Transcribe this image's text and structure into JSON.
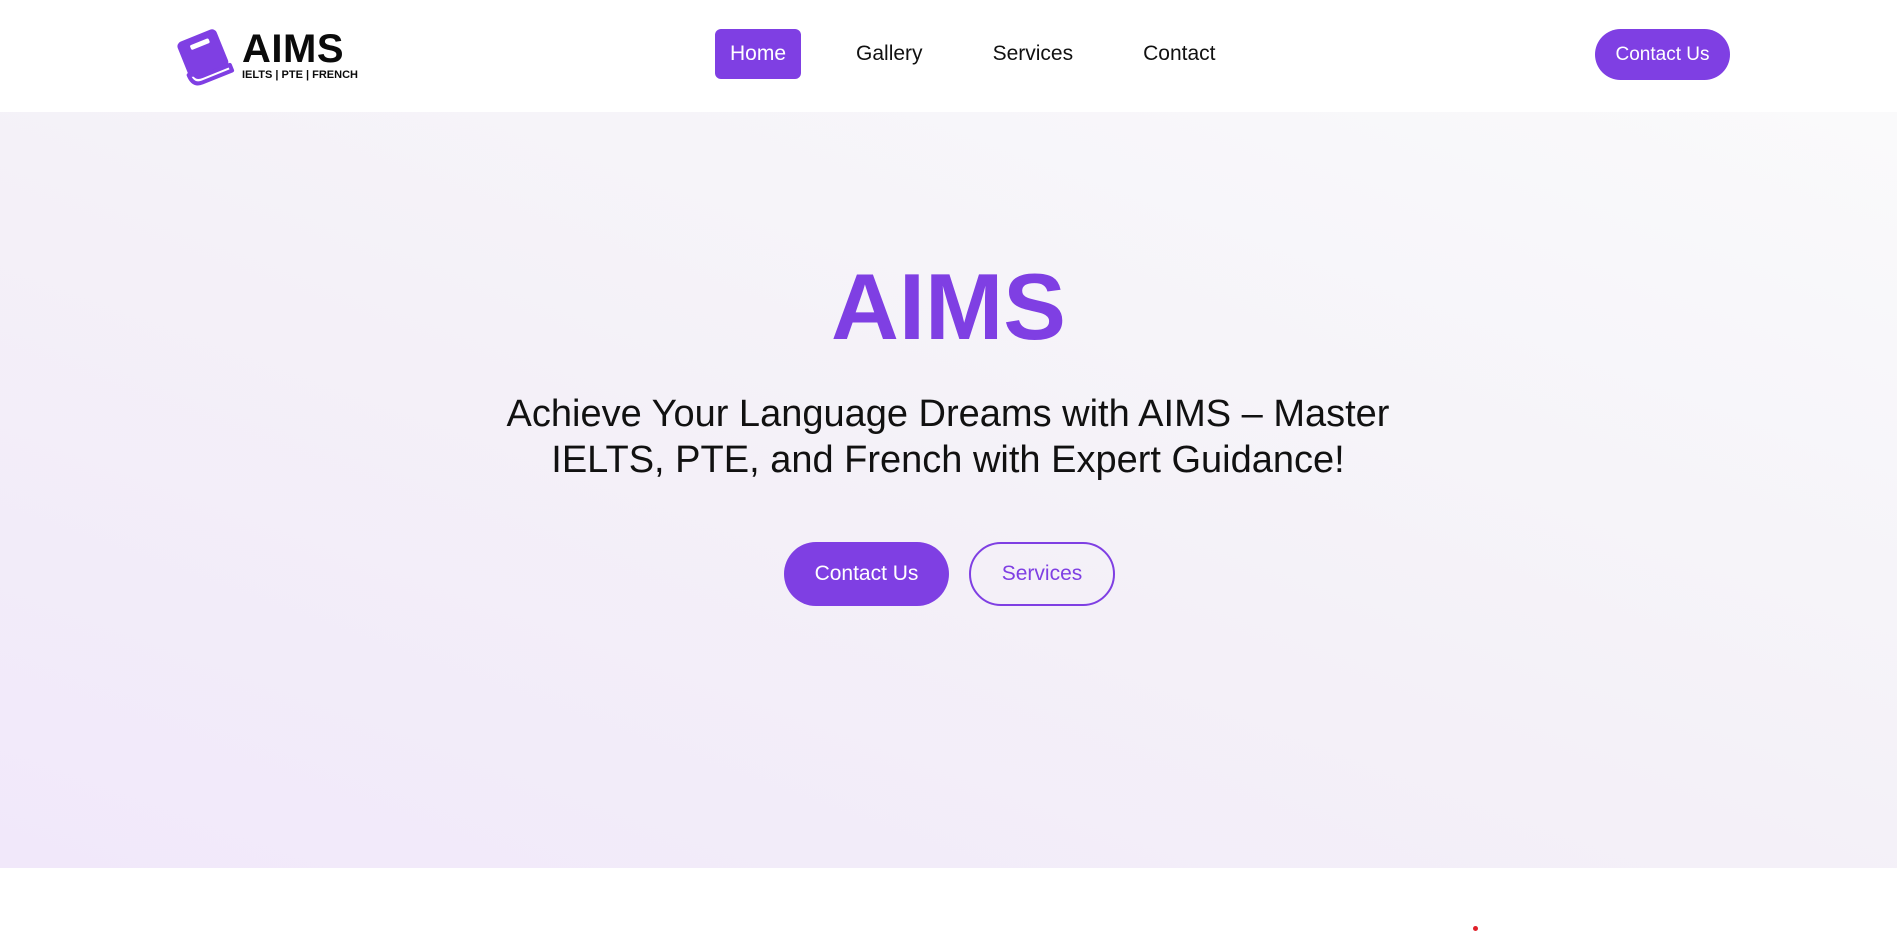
{
  "brand": {
    "name": "AIMS",
    "tagline": "IELTS | PTE | FRENCH",
    "logo_icon": "book-icon",
    "accent_color": "#7f3fe3"
  },
  "nav": {
    "items": [
      {
        "label": "Home",
        "active": true
      },
      {
        "label": "Gallery",
        "active": false
      },
      {
        "label": "Services",
        "active": false
      },
      {
        "label": "Contact",
        "active": false
      }
    ],
    "cta_label": "Contact Us"
  },
  "hero": {
    "title": "AIMS",
    "subtitle_line1": "Achieve Your Language Dreams with AIMS – Master",
    "subtitle_line2": "IELTS, PTE, and French with Expert Guidance!",
    "primary_button": "Contact Us",
    "secondary_button": "Services"
  }
}
